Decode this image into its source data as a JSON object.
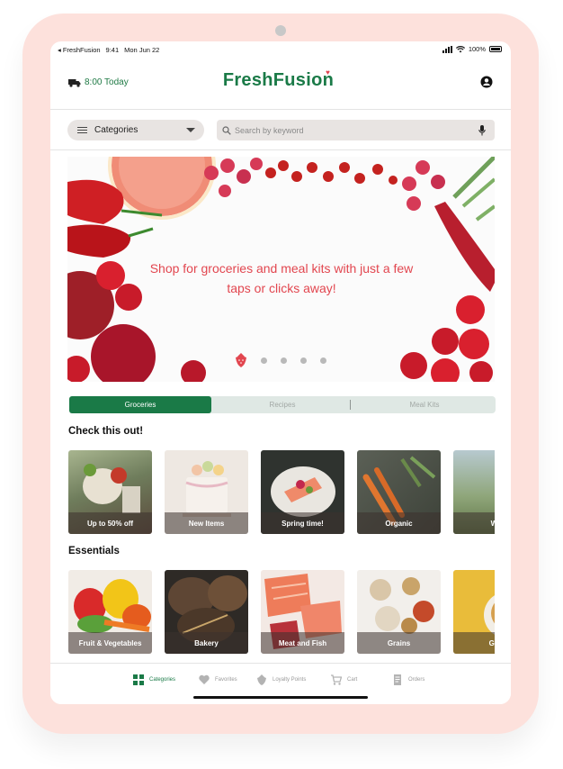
{
  "status": {
    "carrier": "◂ FreshFusion",
    "time": "9:41",
    "date": "Mon Jun 22",
    "battery": "100%"
  },
  "header": {
    "delivery": "8:00 Today",
    "brand": "FreshFusion"
  },
  "search": {
    "categories_label": "Categories",
    "placeholder": "Search by keyword"
  },
  "hero": {
    "text": "Shop for groceries and meal kits with just a few taps or clicks away!",
    "slide_count": 5,
    "active_slide": 0
  },
  "segments": [
    {
      "label": "Groceries",
      "active": true
    },
    {
      "label": "Recipes",
      "active": false
    },
    {
      "label": "Meal Kits",
      "active": false
    }
  ],
  "check_out": {
    "title": "Check this out!",
    "items": [
      {
        "label": "Up to 50% off",
        "color": "#7b8a6a"
      },
      {
        "label": "New Items",
        "color": "#e9e2dc"
      },
      {
        "label": "Spring time!",
        "color": "#3a3f3a"
      },
      {
        "label": "Organic",
        "color": "#4a4e46"
      },
      {
        "label": "Wi",
        "color": "#8aa4a8"
      }
    ]
  },
  "essentials": {
    "title": "Essentials",
    "items": [
      {
        "label": "Fruit & Vegetables",
        "color": "#d8a43a"
      },
      {
        "label": "Bakery",
        "color": "#4a3c30"
      },
      {
        "label": "Meat and Fish",
        "color": "#e98a6c"
      },
      {
        "label": "Grains",
        "color": "#e9e4df"
      },
      {
        "label": "Gra",
        "color": "#e3b93c"
      }
    ]
  },
  "tabs": [
    {
      "label": "Categories",
      "icon": "grid-icon",
      "active": true
    },
    {
      "label": "Favorites",
      "icon": "heart-icon",
      "active": false
    },
    {
      "label": "Loyalty Points",
      "icon": "strawberry-icon",
      "active": false
    },
    {
      "label": "Cart",
      "icon": "cart-icon",
      "active": false
    },
    {
      "label": "Orders",
      "icon": "receipt-icon",
      "active": false
    }
  ],
  "colors": {
    "brand": "#1a7a47",
    "accent": "#e2464f",
    "device": "#fde1dc"
  }
}
